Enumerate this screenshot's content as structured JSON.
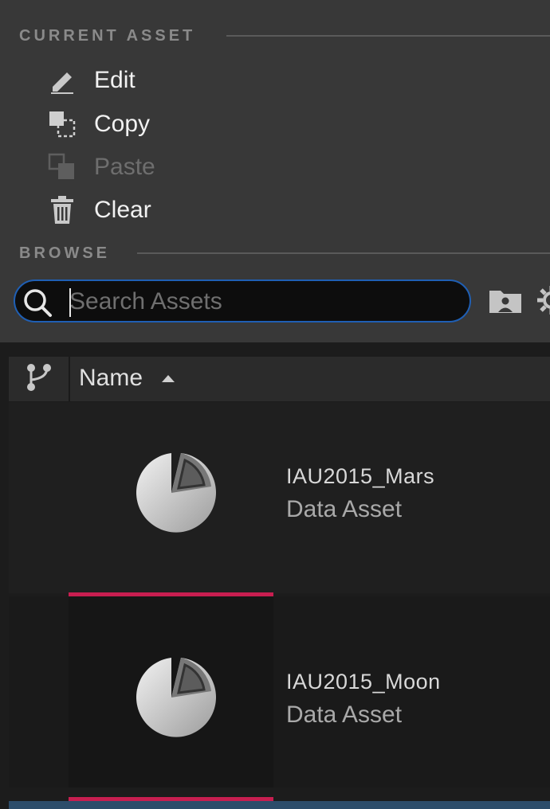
{
  "sections": {
    "current_asset": "CURRENT ASSET",
    "browse": "BROWSE"
  },
  "menu": {
    "edit": "Edit",
    "copy": "Copy",
    "paste": "Paste",
    "clear": "Clear"
  },
  "search": {
    "placeholder": "Search Assets",
    "value": ""
  },
  "columns": {
    "name": "Name",
    "sort": "ascending"
  },
  "assets": [
    {
      "name": "IAU2015_Mars",
      "type": "Data Asset"
    },
    {
      "name": "IAU2015_Moon",
      "type": "Data Asset"
    }
  ],
  "colors": {
    "accent_search": "#1f5fb4",
    "selection": "#c81e50"
  },
  "icons": {
    "edit": "pencil-icon",
    "copy": "copy-icon",
    "paste": "paste-icon",
    "clear": "trash-icon",
    "search": "search-icon",
    "folder": "folder-user-icon",
    "settings": "gear-icon",
    "source": "branch-icon",
    "thumbnail": "data-asset-pie-icon"
  }
}
